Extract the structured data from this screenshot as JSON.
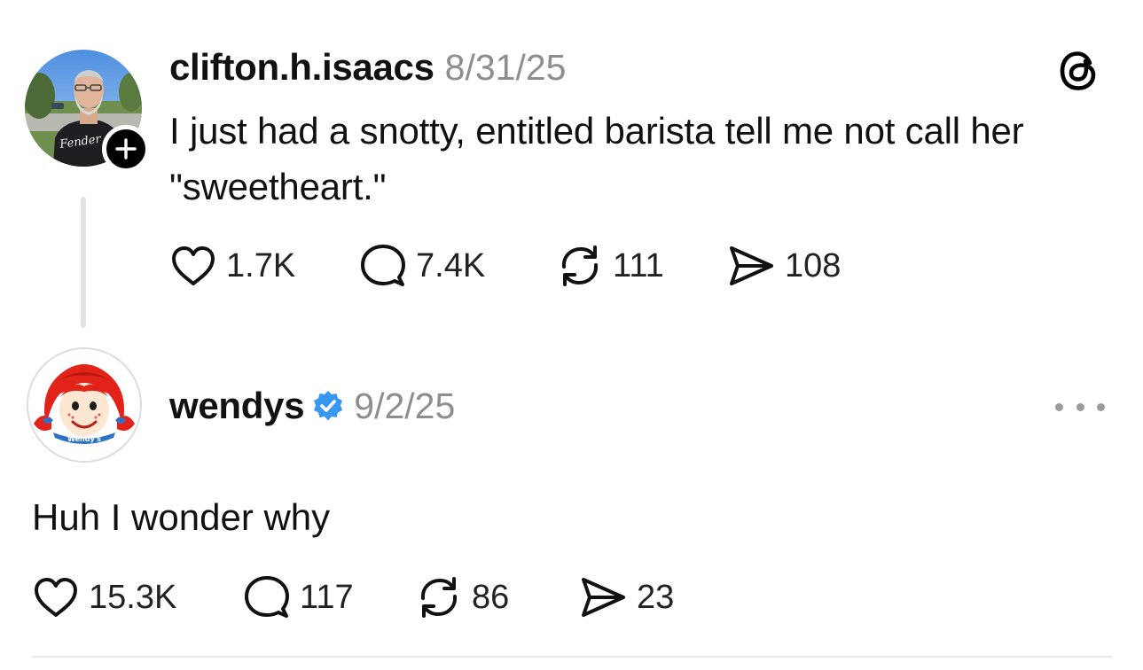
{
  "posts": [
    {
      "username": "clifton.h.isaacs",
      "timestamp": "8/31/25",
      "text": "I just had a snotty, entitled barista tell me not call her \"sweetheart.\"",
      "stats": {
        "likes": "1.7K",
        "replies": "7.4K",
        "reposts": "111",
        "shares": "108"
      },
      "avatar_text": "Fender"
    },
    {
      "username": "wendys",
      "timestamp": "9/2/25",
      "text": "Huh I wonder why",
      "stats": {
        "likes": "15.3K",
        "replies": "117",
        "reposts": "86",
        "shares": "23"
      },
      "avatar_text": "Wendy's"
    }
  ],
  "icons": {
    "like": "heart-icon",
    "reply": "speech-bubble-icon",
    "repost": "repost-arrows-icon",
    "share": "paper-plane-icon",
    "follow": "plus-icon",
    "app_logo": "threads-logo-icon",
    "verified": "verified-badge-icon",
    "more": "more-dots-icon"
  },
  "colors": {
    "text": "#111111",
    "muted": "#8e8e8e",
    "verified": "#3897f0",
    "wendys_hair": "#e2231a"
  }
}
